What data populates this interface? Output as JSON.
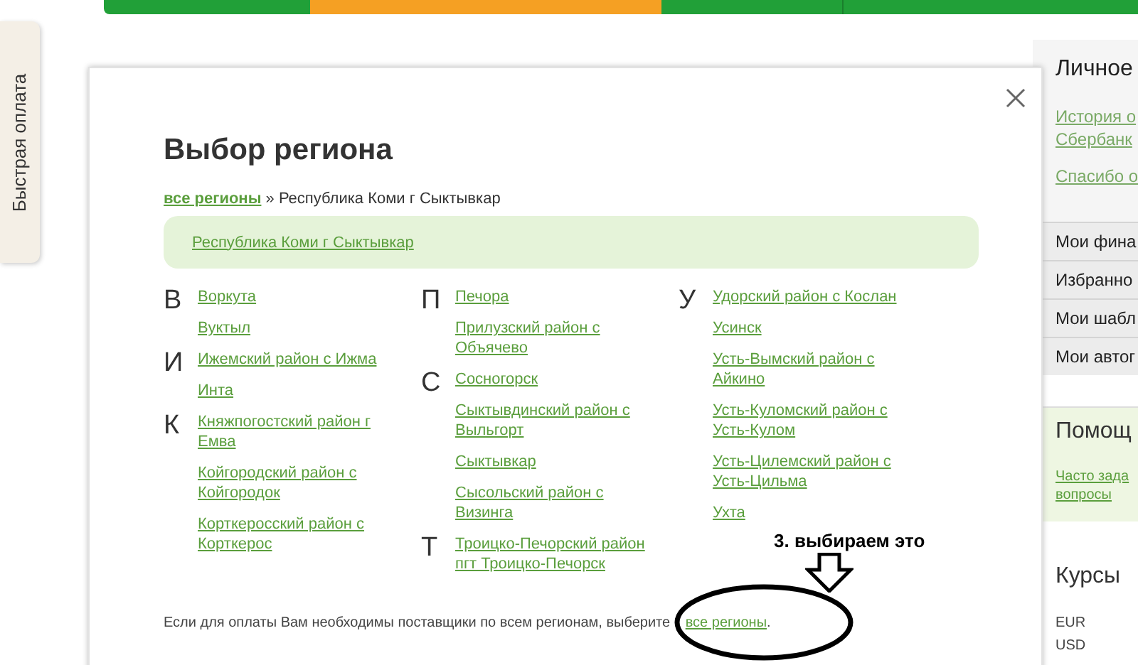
{
  "quick_pay_tab": {
    "label": "Быстрая оплата"
  },
  "sidebar": {
    "title": "Личное",
    "links": [
      "История о\nСбербанк",
      "Спасибо о"
    ],
    "menu": [
      "Мои фина",
      "Избранно",
      "Мои шабл",
      "Мои автог"
    ],
    "help": {
      "title": "Помощ",
      "link": "Часто зада\nвопросы"
    },
    "rates": {
      "title": "Курсы",
      "currencies": [
        "EUR",
        "USD"
      ]
    }
  },
  "modal": {
    "title": "Выбор региона",
    "breadcrumb": {
      "link": "все регионы",
      "separator": "»",
      "current": "Республика Коми г Сыктывкар"
    },
    "selected_region": "Республика Коми г Сыктывкар",
    "columns": [
      {
        "groups": [
          {
            "letter": "В",
            "regions": [
              "Воркута",
              "Вуктыл"
            ]
          },
          {
            "letter": "И",
            "regions": [
              "Ижемский район с Ижма",
              "Инта"
            ]
          },
          {
            "letter": "К",
            "regions": [
              "Княжпогостский район г Емва",
              "Койгородский район с Койгородок",
              "Корткеросский район с Корткерос"
            ]
          }
        ]
      },
      {
        "groups": [
          {
            "letter": "П",
            "regions": [
              "Печора",
              "Прилузский район с Объячево"
            ]
          },
          {
            "letter": "С",
            "regions": [
              "Сосногорск",
              "Сыктывдинский район с Выльгорт",
              "Сыктывкар",
              "Сысольский район с Визинга"
            ]
          },
          {
            "letter": "Т",
            "regions": [
              "Троицко-Печорский район пгт Троицко-Печорск"
            ]
          }
        ]
      },
      {
        "groups": [
          {
            "letter": "У",
            "regions": [
              "Удорский район с Кослан",
              "Усинск",
              "Усть-Вымский район с Айкино",
              "Усть-Куломский район с Усть-Кулом",
              "Усть-Цилемский район с Усть-Цильма",
              "Ухта"
            ]
          }
        ]
      }
    ],
    "footer": {
      "text": "Если для оплаты Вам необходимы поставщики по всем регионам, выберите",
      "link": "все регионы",
      "end": "."
    }
  },
  "annotation": {
    "text": "3. выбираем это"
  }
}
